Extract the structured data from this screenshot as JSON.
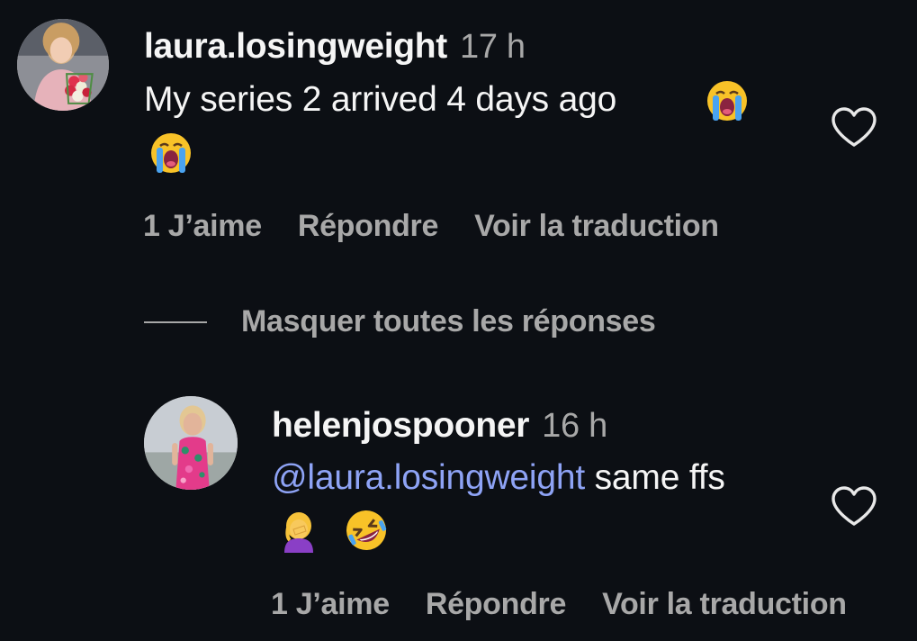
{
  "comments": [
    {
      "username": "laura.losingweight",
      "time": "17 h",
      "text": "My series 2 arrived 4 days ago",
      "likes_label": "1 J’aime",
      "reply_label": "Répondre",
      "translate_label": "Voir la traduction",
      "emojis": [
        "loudly-crying-face",
        "loudly-crying-face"
      ]
    },
    {
      "username": "helenjospooner",
      "time": "16 h",
      "mention": "@laura.losingweight",
      "text": " same ffs",
      "likes_label": "1 J’aime",
      "reply_label": "Répondre",
      "translate_label": "Voir la traduction",
      "emojis": [
        "woman-facepalming",
        "rolling-on-floor-laughing"
      ]
    }
  ],
  "replies_toggle": {
    "label": "Masquer toutes les réponses"
  },
  "colors": {
    "background": "#0c0f14",
    "primary_text": "#f5f5f5",
    "secondary_text": "#a8a8a8",
    "mention": "#8ea3f5"
  }
}
